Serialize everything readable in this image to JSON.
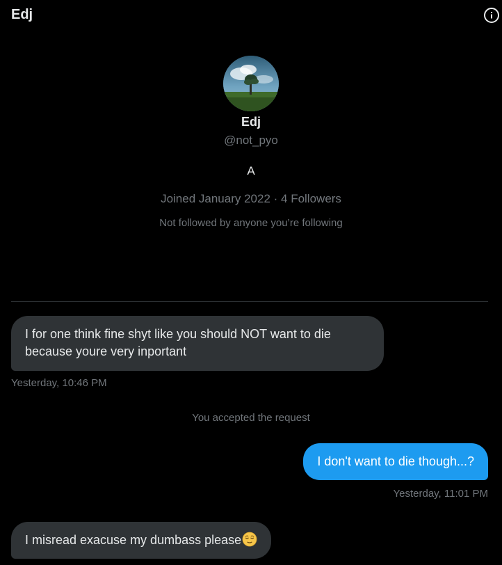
{
  "header": {
    "title": "Edj",
    "info_icon": "info-icon"
  },
  "profile": {
    "avatar": "avatar-image",
    "name": "Edj",
    "handle": "@not_pyo",
    "bio": "A",
    "joined": "Joined January 2022",
    "separator": " · ",
    "followers": "4 Followers",
    "follow_note": "Not followed by anyone you’re following"
  },
  "messages": [
    {
      "direction": "received",
      "text": "I for one think fine shyt like you should NOT want to die because youre very inportant",
      "time": "Yesterday, 10:46 PM"
    },
    {
      "direction": "sent",
      "text": "I don't want to die though...?",
      "time": "Yesterday, 11:01 PM"
    },
    {
      "direction": "received",
      "text": "I misread exacuse my dumbass please",
      "emoji": "relieved-face-emoji"
    }
  ],
  "system_note": "You accepted the request",
  "colors": {
    "background": "#000000",
    "received_bubble": "#2f3336",
    "sent_bubble": "#1d9bf0",
    "muted_text": "#71767b",
    "primary_text": "#e7e9ea"
  }
}
